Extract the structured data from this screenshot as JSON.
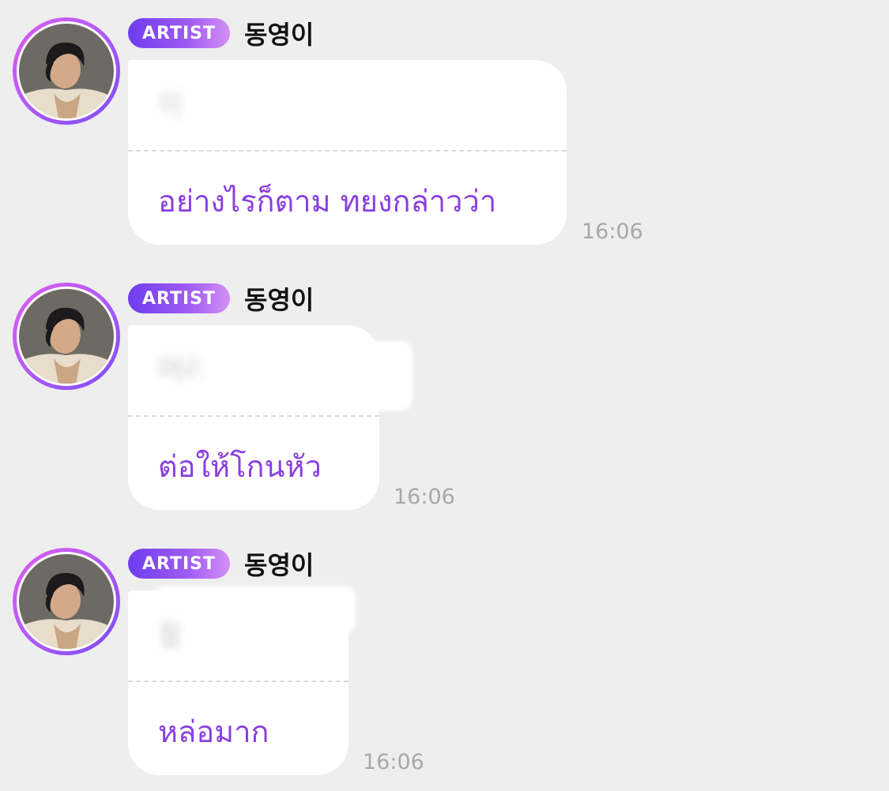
{
  "messages": [
    {
      "badge": "ARTIST",
      "sender": "동영이",
      "original": "이",
      "translation": "อย่างไรก็ตาม ทยงกล่าวว่า",
      "time": "16:06"
    },
    {
      "badge": "ARTIST",
      "sender": "동영이",
      "original": "머리",
      "translation": "ต่อให้โกนหัว",
      "time": "16:06"
    },
    {
      "badge": "ARTIST",
      "sender": "동영이",
      "original": "잘",
      "translation": "หล่อมาก",
      "time": "16:06"
    }
  ],
  "colors": {
    "background": "#eeeeee",
    "bubble": "#ffffff",
    "translation_text": "#8a3fe0",
    "badge_start": "#6e3cf0",
    "badge_end": "#d48ff5",
    "avatar_ring": "#b45cf5",
    "timestamp": "#a8a8a8"
  },
  "icons": {
    "avatar": "artist-profile-photo"
  }
}
